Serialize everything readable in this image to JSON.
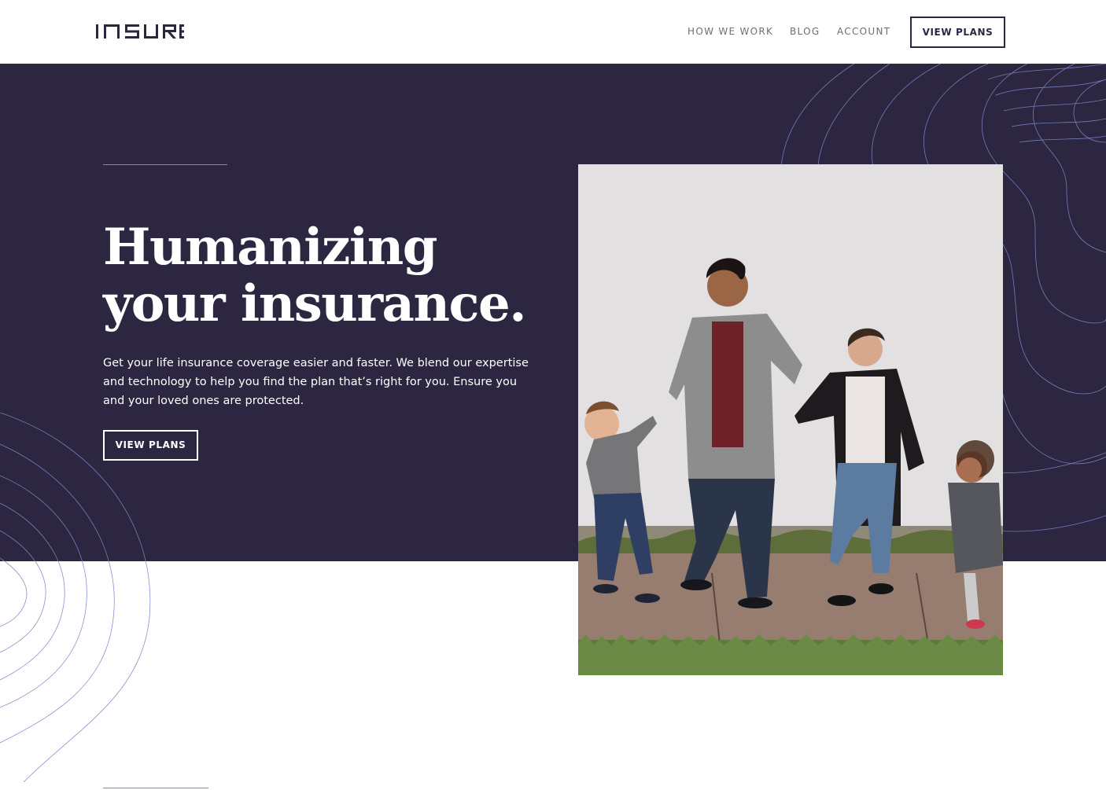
{
  "header": {
    "logo_text": "INSURE",
    "nav": [
      {
        "label": "HOW WE WORK"
      },
      {
        "label": "BLOG"
      },
      {
        "label": "ACCOUNT"
      }
    ],
    "cta_label": "VIEW PLANS"
  },
  "hero": {
    "title_line1": "Humanizing",
    "title_line2": "your insurance.",
    "description": "Get your life insurance coverage easier and faster. We blend our expertise and technology to help you find the plan that’s right for you. Ensure you and your loved ones are protected.",
    "cta_label": "VIEW PLANS",
    "photo_alt": "family walking hand in hand"
  },
  "colors": {
    "hero_bg": "#2c2640",
    "pattern_line": "#7b86c8",
    "text_dark": "#2c2640",
    "nav_text": "#6f6c78"
  }
}
